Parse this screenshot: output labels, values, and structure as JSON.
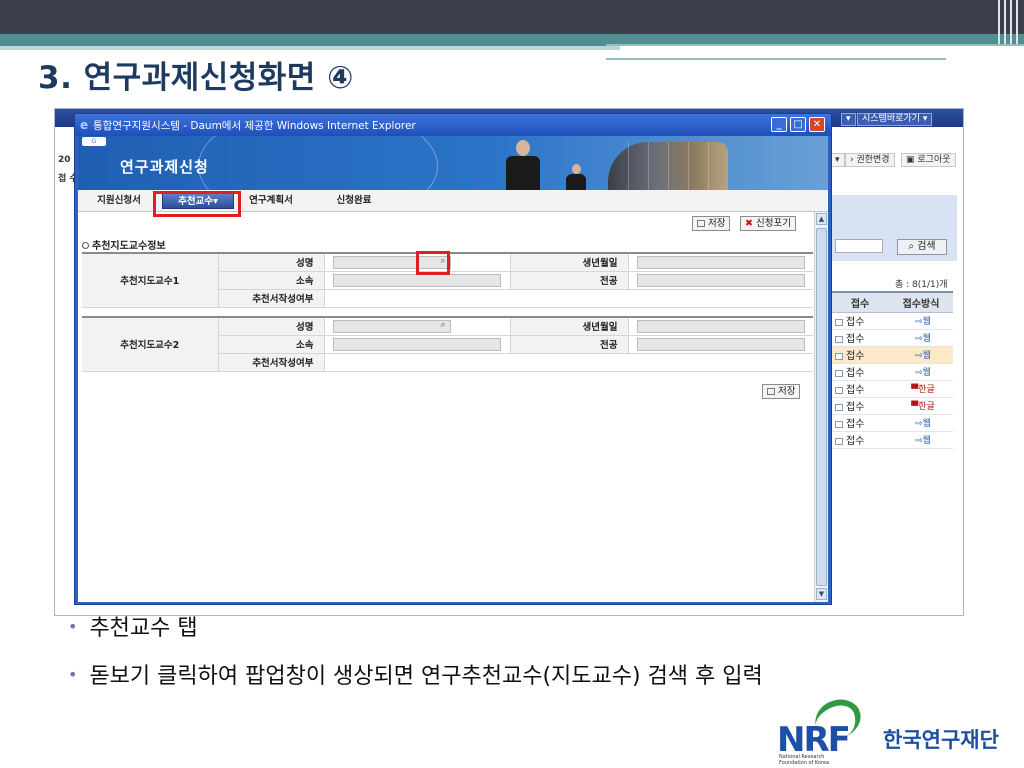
{
  "slide": {
    "title": "3. 연구과제신청화면 ④",
    "bullets": [
      "추천교수 탭",
      "돋보기 클릭하여 팝업창이 생상되면 연구추천교수(지도교수) 검색 후 입력"
    ]
  },
  "background_window": {
    "system_shortcut": "시스템바로가기",
    "links": [
      "권한변경",
      "로그아웃"
    ],
    "side_text": [
      "20",
      "접 수"
    ],
    "search_button": "검색",
    "count_text": "총 : 8(1/1)개",
    "table": {
      "headers": [
        "접수",
        "접수방식"
      ],
      "rows": [
        {
          "status": "접수",
          "method": "웹"
        },
        {
          "status": "접수",
          "method": "웹"
        },
        {
          "status": "접수",
          "method": "웹"
        },
        {
          "status": "접수",
          "method": "웹"
        },
        {
          "status": "접수",
          "method": "한글"
        },
        {
          "status": "접수",
          "method": "한글"
        },
        {
          "status": "접수",
          "method": "웹"
        },
        {
          "status": "접수",
          "method": "웹"
        }
      ]
    }
  },
  "popup": {
    "window_title": "통합연구지원시스템 - Daum에서 제공한 Windows Internet Explorer",
    "banner_title": "연구과제신청",
    "tabs": [
      "지원신청서",
      "추천교수",
      "연구계획서",
      "신청완료"
    ],
    "active_tab_index": 1,
    "buttons": {
      "save": "저장",
      "cancel": "신청포기",
      "save_bottom": "저장"
    },
    "section_title": "추천지도교수정보",
    "professors": [
      {
        "group": "추천지도교수1",
        "name_label": "성명",
        "affiliation_label": "소속",
        "recommendation_label": "추천서작성여부",
        "birth_label": "생년월일",
        "major_label": "전공"
      },
      {
        "group": "추천지도교수2",
        "name_label": "성명",
        "affiliation_label": "소속",
        "recommendation_label": "추천서작성여부",
        "birth_label": "생년월일",
        "major_label": "전공"
      }
    ]
  },
  "logo": {
    "letters": "NRF",
    "english": [
      "National Research",
      "Foundation of Korea"
    ],
    "korean": "한국연구재단"
  },
  "colors": {
    "title": "#1d3a5f",
    "teal": "#4f8f92",
    "highlight_red": "#e02020",
    "active_tab": "#2d4f98",
    "logo_blue": "#1d4fa6",
    "logo_green": "#2e9a43"
  }
}
